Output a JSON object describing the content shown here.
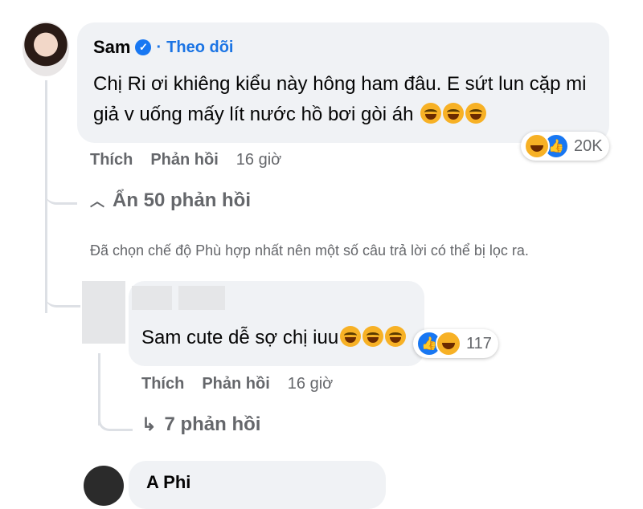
{
  "comment": {
    "author": "Sam",
    "verified_icon": "verified-badge-icon",
    "follow_label": "Theo dõi",
    "line1": "Chị Ri ơi khiêng kiểu này hông ham đâu. E sứt lun cặp mi",
    "line2": "giả v uống mấy lít nước hồ bơi gòi áh",
    "emoji_icon": "laughing-tears-emoji",
    "reaction_count": "20K",
    "like_label": "Thích",
    "reply_label": "Phản hồi",
    "time": "16 giờ"
  },
  "hide_replies_label": "Ẩn 50 phản hồi",
  "filter_note": "Đã chọn chế độ Phù hợp nhất nên một số câu trả lời có thể bị lọc ra.",
  "reply": {
    "text": "Sam cute dễ sợ chị iuu",
    "reaction_count": "117",
    "like_label": "Thích",
    "reply_label": "Phản hồi",
    "time": "16 giờ",
    "view_replies_label": "7 phản hồi"
  },
  "next_comment": {
    "author_partial": "A Phi"
  },
  "colors": {
    "bubble": "#f0f2f5",
    "follow": "#1b74e4",
    "secondary_text": "#65676b",
    "like": "#1877f2",
    "haha": "#f7b125"
  }
}
